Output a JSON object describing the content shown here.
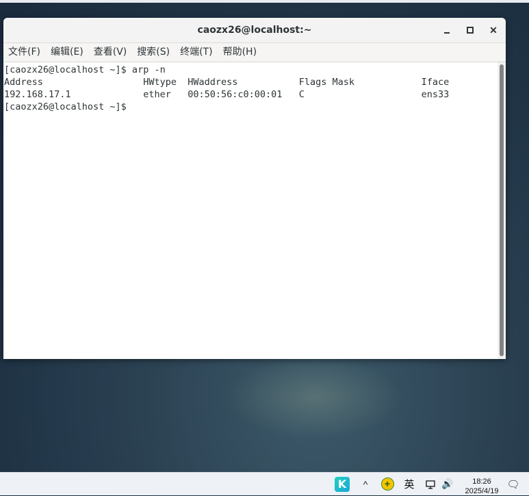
{
  "window": {
    "title": "caozx26@localhost:~",
    "controls": {
      "minimize": "minimize-icon",
      "maximize": "maximize-icon",
      "close": "close-icon",
      "close_glyph": "✕"
    }
  },
  "menu": [
    {
      "label": "文件(F)"
    },
    {
      "label": "编辑(E)"
    },
    {
      "label": "查看(V)"
    },
    {
      "label": "搜索(S)"
    },
    {
      "label": "终端(T)"
    },
    {
      "label": "帮助(H)"
    }
  ],
  "terminal": {
    "lines": [
      "[caozx26@localhost ~]$ arp -n",
      "Address                  HWtype  HWaddress           Flags Mask            Iface",
      "192.168.17.1             ether   00:50:56:c0:00:01   C                     ens33",
      "[caozx26@localhost ~]$ "
    ]
  },
  "taskbar": {
    "app_letter": "K",
    "chevron": "^",
    "ime_symbol": "+",
    "language": "英",
    "volume_glyph": "🔊",
    "time": "18:26",
    "date": "2025/4/19",
    "notification_glyph": "🗨"
  }
}
